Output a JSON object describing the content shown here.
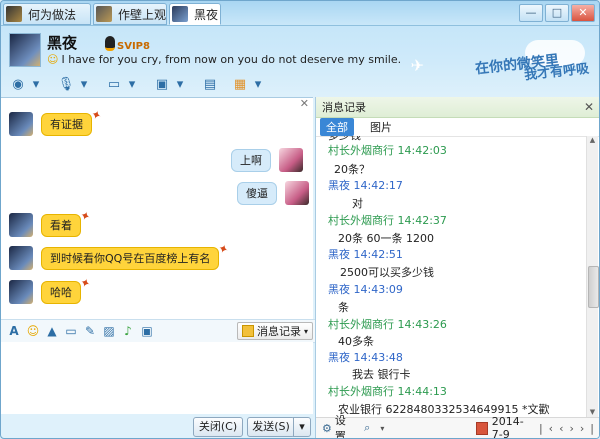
{
  "tabs": [
    {
      "label": "何为做法"
    },
    {
      "label": "作壁上观"
    },
    {
      "label": "黑夜"
    }
  ],
  "window_buttons": {
    "min": "—",
    "max": "□",
    "close": "✕"
  },
  "header": {
    "nickname": "黑夜",
    "level_badge": "SVIP8",
    "signature": "I have for you cry, from now on you do not deserve my smile.",
    "deco_line1": "在你的微笑里",
    "deco_line2": "我才有呼吸"
  },
  "messages": [
    {
      "text": "有证据",
      "side": "left"
    },
    {
      "text": "上啊",
      "side": "right"
    },
    {
      "text": "傻逼",
      "side": "right"
    },
    {
      "text": "看着",
      "side": "left"
    },
    {
      "text": "到时候看你QQ号在百度榜上有名",
      "side": "left"
    },
    {
      "text": "哈哈",
      "side": "left"
    }
  ],
  "input_toolbar": {
    "history_label": "消息记录"
  },
  "buttons": {
    "close": "关闭(C)",
    "send": "发送(S)",
    "send_dropdown": "▾"
  },
  "history": {
    "title": "消息记录",
    "tab_all": "全部",
    "tab_images": "图片",
    "entries": [
      {
        "type": "green",
        "text": "村长外烟商行  14:42:03"
      },
      {
        "type": "text",
        "text": "20条？"
      },
      {
        "type": "blue",
        "text": "黑夜      14:42:17"
      },
      {
        "type": "text",
        "text": "对"
      },
      {
        "type": "green",
        "text": "村长外烟商行  14:42:37"
      },
      {
        "type": "text",
        "text": "20条 60一条  1200"
      },
      {
        "type": "blue",
        "text": "黑夜      14:42:51"
      },
      {
        "type": "text",
        "text": "2500可以买多少钱"
      },
      {
        "type": "blue",
        "text": "黑夜      14:43:09"
      },
      {
        "type": "text",
        "text": "条"
      },
      {
        "type": "green",
        "text": "村长外烟商行  14:43:26"
      },
      {
        "type": "text",
        "text": "40多条"
      },
      {
        "type": "blue",
        "text": "黑夜      14:43:48"
      },
      {
        "type": "text",
        "text": "我去 银行卡"
      },
      {
        "type": "green",
        "text": "村长外烟商行  14:44:13"
      },
      {
        "type": "text",
        "text": "农业银行 6228480332534649915  *文歡"
      }
    ],
    "footer_settings": "设置",
    "footer_date": "2014-7-9"
  }
}
